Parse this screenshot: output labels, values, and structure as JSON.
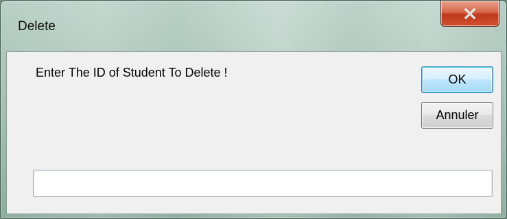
{
  "window": {
    "title": "Delete",
    "close_icon": "close-icon"
  },
  "dialog": {
    "prompt": "Enter The ID of Student To Delete !",
    "ok_label": "OK",
    "cancel_label": "Annuler",
    "input_value": "",
    "input_placeholder": ""
  },
  "colors": {
    "close_button": "#c7452a",
    "ok_button_border": "#3c7fb1",
    "client_background": "#f0f0f0"
  }
}
